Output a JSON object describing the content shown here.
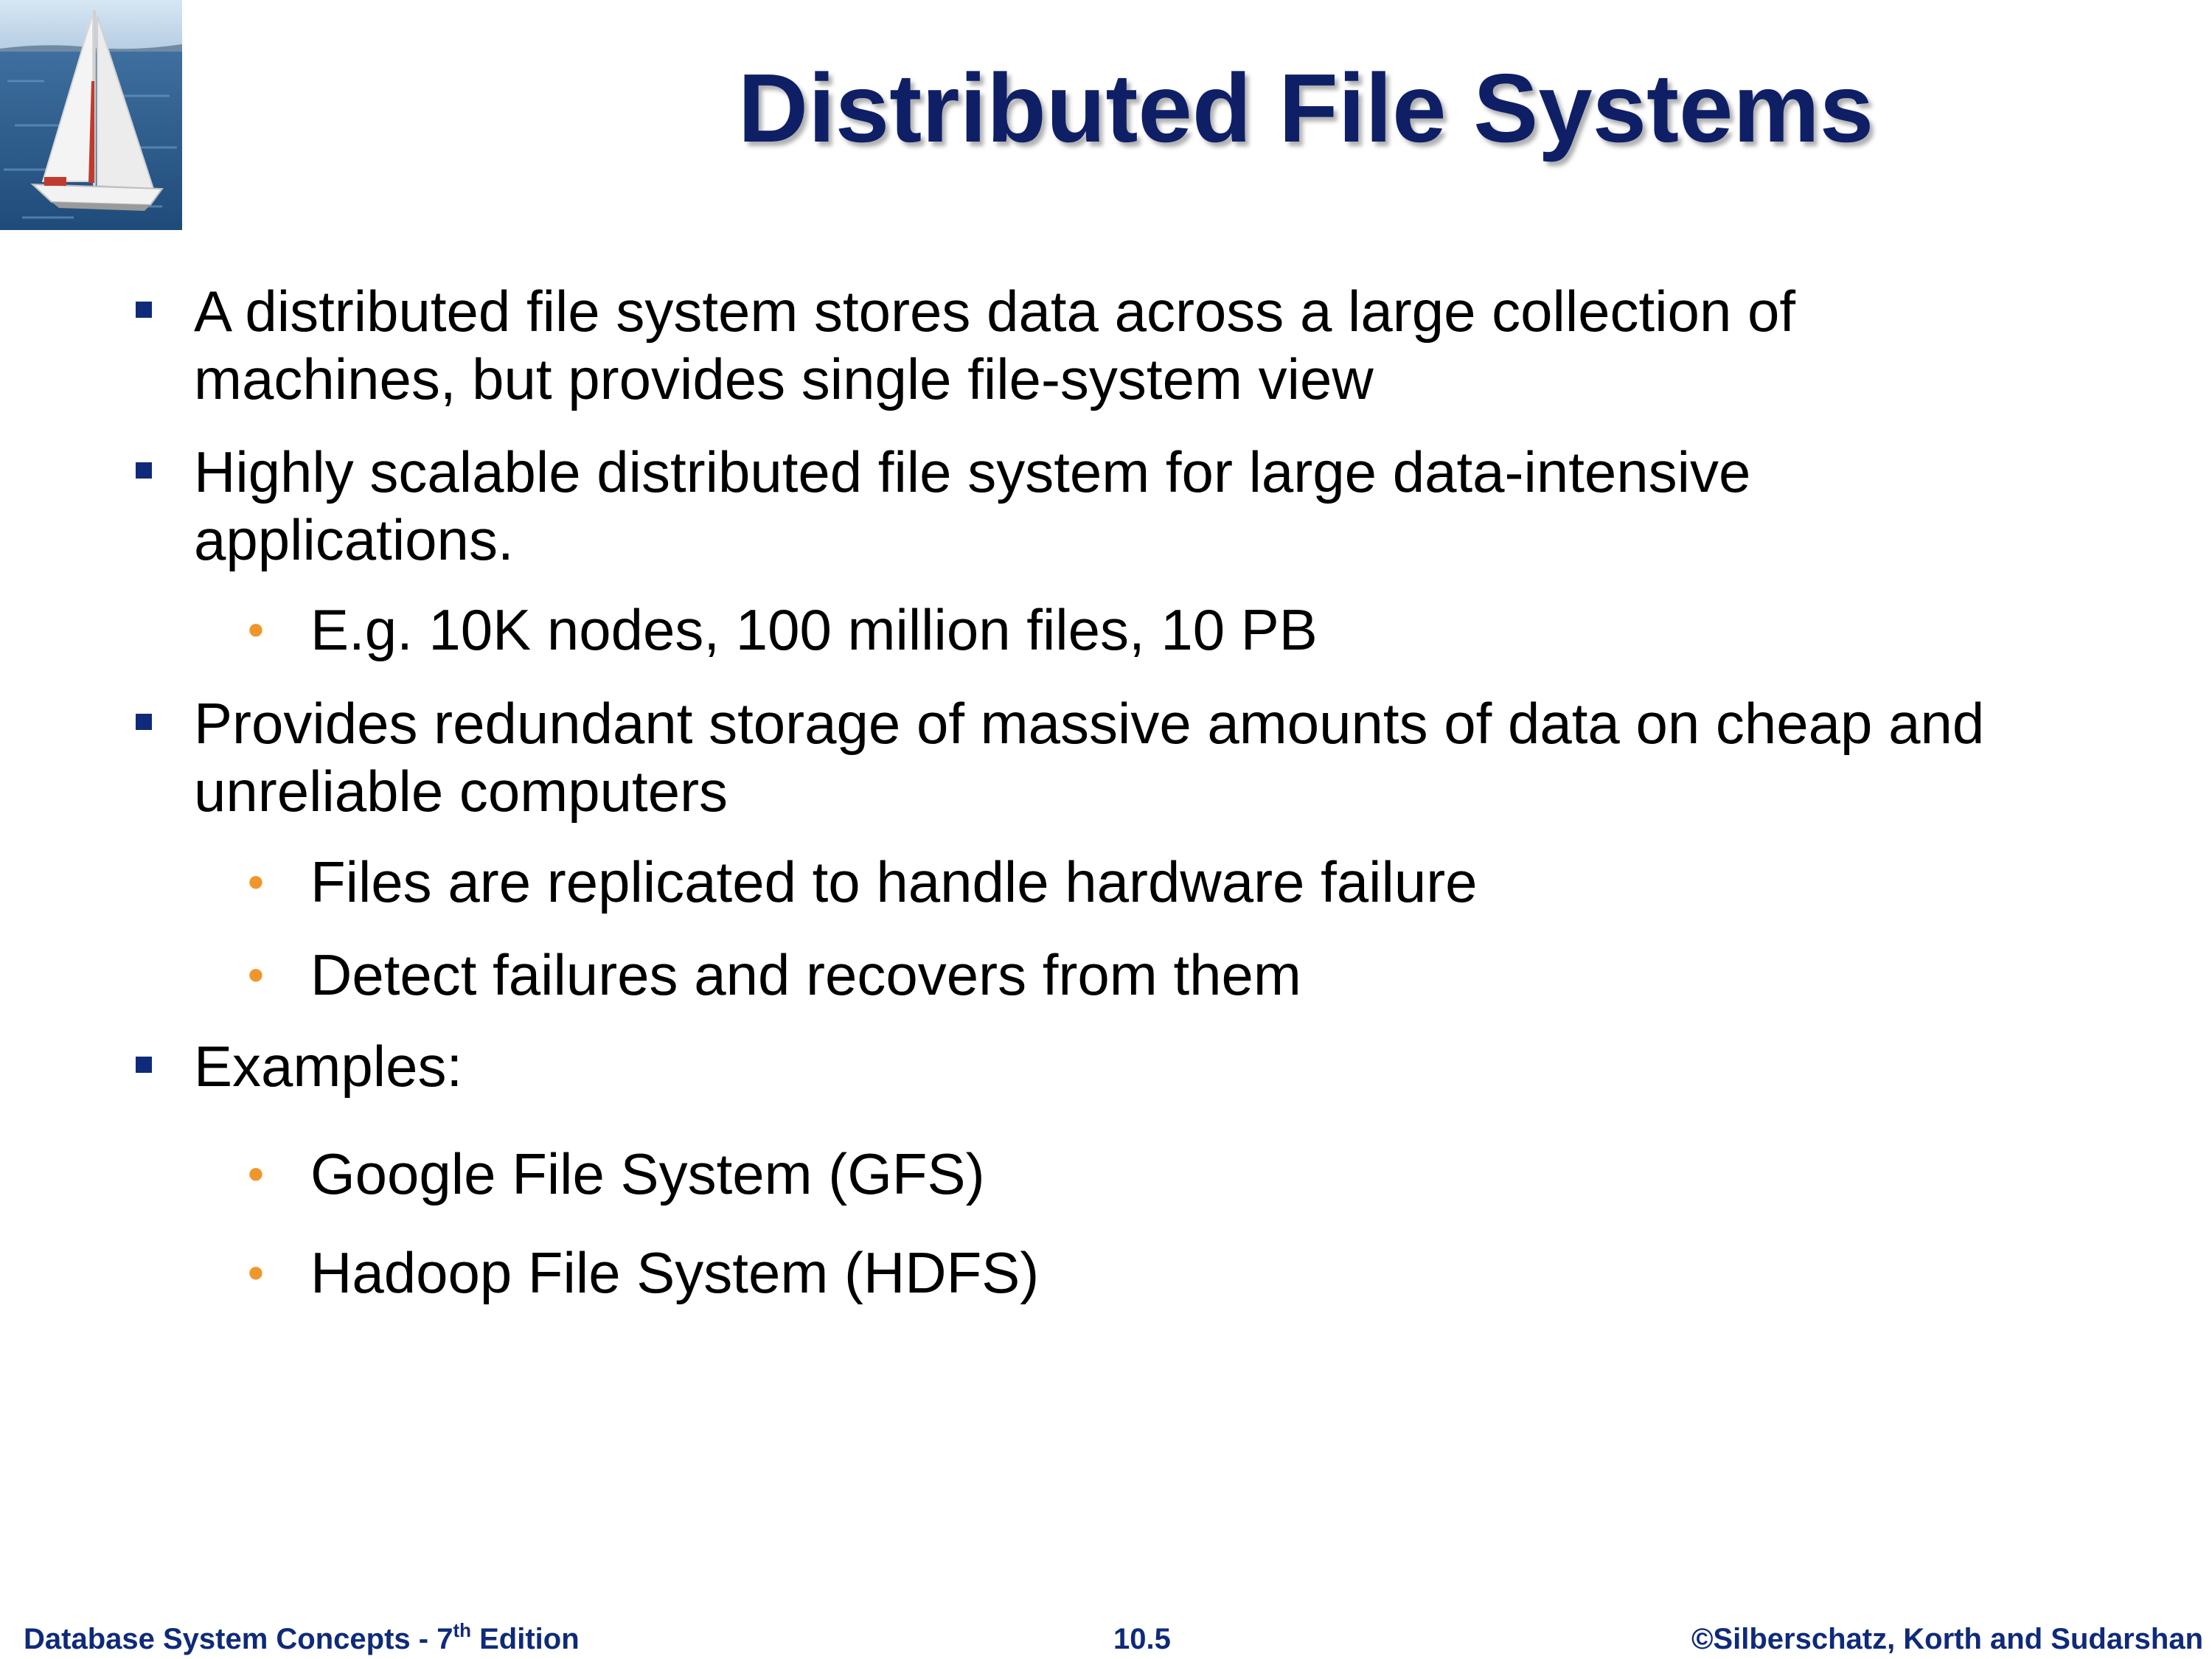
{
  "slide": {
    "title": "Distributed File Systems",
    "logo_icon": "sailboat-photo"
  },
  "bullets": [
    {
      "text": "A distributed file system stores data across a large collection of machines, but provides single file-system view",
      "line1": "A distributed file system stores data across a large collection of",
      "line2": "machines, but provides single file-system view"
    },
    {
      "text": "Highly scalable distributed file system for large data-intensive applications.",
      "line1": "Highly scalable distributed file system for large data-intensive",
      "line2": "applications.",
      "sub": [
        {
          "text": "E.g. 10K nodes, 100 million files, 10 PB"
        }
      ]
    },
    {
      "text": "Provides redundant storage of massive amounts of data on cheap and unreliable computers",
      "line1": "Provides redundant storage of massive amounts of data on cheap and",
      "line2": "unreliable computers",
      "sub": [
        {
          "text": "Files are replicated to handle hardware failure"
        },
        {
          "text": "Detect failures and recovers from them"
        }
      ]
    },
    {
      "text": "Examples:",
      "sub": [
        {
          "text": "Google File System (GFS)"
        },
        {
          "text": "Hadoop File System (HDFS)"
        }
      ]
    }
  ],
  "footer": {
    "left_prefix": "Database System Concepts - 7",
    "left_sup": "th",
    "left_suffix": " Edition",
    "page_number": "10.5",
    "copyright": "©Silberschatz, Korth and Sudarshan"
  },
  "colors": {
    "title": "#0f1f66",
    "square_bullet": "#0f2a7a",
    "dot_bullet": "#f0962c",
    "footer": "#0f2a7a"
  }
}
